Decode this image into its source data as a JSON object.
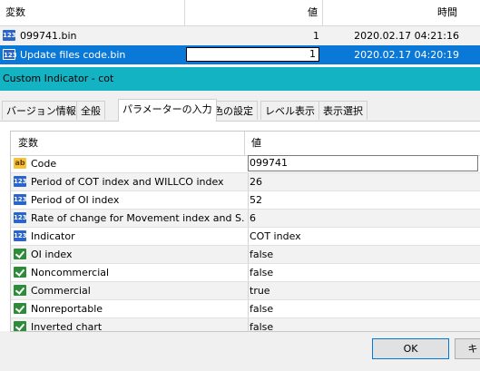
{
  "top_table": {
    "headers": {
      "variable": "変数",
      "value": "値",
      "time": "時間"
    },
    "rows": [
      {
        "icon": "123",
        "name": "099741.bin",
        "value": "1",
        "time": "2020.02.17 04:21:16"
      },
      {
        "icon": "123",
        "name": "Update files code.bin",
        "value": "1",
        "time": "2020.02.17 04:20:19"
      }
    ]
  },
  "dialog": {
    "title": "Custom Indicator - cot",
    "tabs": [
      "バージョン情報",
      "全般",
      "パラメーターの入力",
      "色の設定",
      "レベル表示",
      "表示選択"
    ],
    "active_tab": "パラメーターの入力",
    "grid": {
      "headers": {
        "variable": "変数",
        "value": "値"
      },
      "rows": [
        {
          "icon": "ab",
          "name": "Code",
          "value": "099741"
        },
        {
          "icon": "123",
          "name": "Period of COT index and WILLCO index",
          "value": "26"
        },
        {
          "icon": "123",
          "name": "Period of OI index",
          "value": "52"
        },
        {
          "icon": "123",
          "name": "Rate of change for Movement index and S...",
          "value": "6"
        },
        {
          "icon": "123",
          "name": "Indicator",
          "value": "COT index"
        },
        {
          "icon": "bool",
          "name": "OI index",
          "value": "false"
        },
        {
          "icon": "bool",
          "name": "Noncommercial",
          "value": "false"
        },
        {
          "icon": "bool",
          "name": "Commercial",
          "value": "true"
        },
        {
          "icon": "bool",
          "name": "Nonreportable",
          "value": "false"
        },
        {
          "icon": "bool",
          "name": "Inverted chart",
          "value": "false"
        }
      ]
    },
    "buttons": {
      "ok": "OK",
      "cancel": "キ"
    }
  },
  "colors": {
    "selection": "#0a78d7",
    "titlebar": "#14b3c3"
  }
}
